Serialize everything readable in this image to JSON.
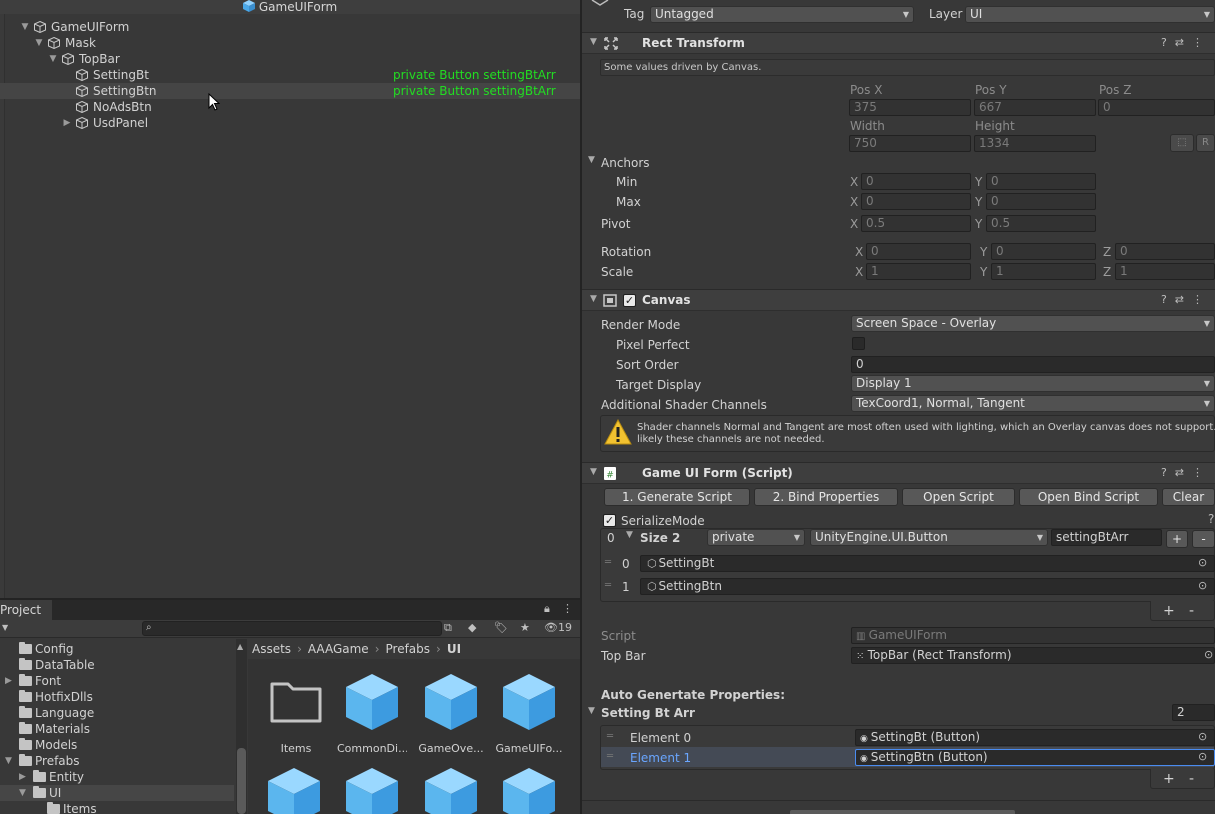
{
  "hierarchy": {
    "title": "GameUIForm",
    "rows": [
      {
        "label": "GameUIForm",
        "green": ""
      },
      {
        "label": "Mask",
        "green": ""
      },
      {
        "label": "TopBar",
        "green": ""
      },
      {
        "label": "SettingBt",
        "green": "private Button settingBtArr"
      },
      {
        "label": "SettingBtn",
        "green": "private Button settingBtArr"
      },
      {
        "label": "NoAdsBtn",
        "green": ""
      },
      {
        "label": "UsdPanel",
        "green": ""
      }
    ]
  },
  "project": {
    "tab": "Project",
    "hidden_count": "19",
    "tree": [
      "Config",
      "DataTable",
      "Font",
      "HotfixDlls",
      "Language",
      "Materials",
      "Models",
      "Prefabs",
      "Entity",
      "UI",
      "Items"
    ],
    "breadcrumb": [
      "Assets",
      "AAAGame",
      "Prefabs",
      "UI"
    ],
    "assets": [
      "Items",
      "CommonDi...",
      "GameOve...",
      "GameUIFo..."
    ]
  },
  "inspector": {
    "tag_label": "Tag",
    "tag_value": "Untagged",
    "layer_label": "Layer",
    "layer_value": "UI",
    "rect": {
      "title": "Rect Transform",
      "note": "Some values driven by Canvas.",
      "pos_x_label": "Pos X",
      "pos_y_label": "Pos Y",
      "pos_z_label": "Pos Z",
      "pos_x": "375",
      "pos_y": "667",
      "pos_z": "0",
      "width_label": "Width",
      "height_label": "Height",
      "width": "750",
      "height": "1334",
      "r_button": "R",
      "anchors": "Anchors",
      "min": "Min",
      "max": "Max",
      "min_x": "0",
      "min_y": "0",
      "max_x": "0",
      "max_y": "0",
      "pivot": "Pivot",
      "pivot_x": "0.5",
      "pivot_y": "0.5",
      "rotation": "Rotation",
      "rot_x": "0",
      "rot_y": "0",
      "rot_z": "0",
      "scale": "Scale",
      "scale_x": "1",
      "scale_y": "1",
      "scale_z": "1",
      "ax_x": "X",
      "ax_y": "Y",
      "ax_z": "Z"
    },
    "canvas": {
      "title": "Canvas",
      "render_mode_label": "Render Mode",
      "render_mode": "Screen Space - Overlay",
      "pixel_perfect": "Pixel Perfect",
      "sort_order_label": "Sort Order",
      "sort_order": "0",
      "target_display_label": "Target Display",
      "target_display": "Display 1",
      "shader_channels_label": "Additional Shader Channels",
      "shader_channels": "TexCoord1, Normal, Tangent",
      "warning_line1": "Shader channels Normal and Tangent are most often used with lighting, which an Overlay canvas does not support. Its",
      "warning_line2": "likely these channels are not needed."
    },
    "script": {
      "title": "Game UI Form (Script)",
      "buttons": [
        "1. Generate Script",
        "2. Bind Properties",
        "Open Script",
        "Open Bind Script",
        "Clear"
      ],
      "serialize_mode": "SerializeMode",
      "index": "0",
      "size": "Size 2",
      "access": "private",
      "type": "UnityEngine.UI.Button",
      "var_name": "settingBtArr",
      "plus": "+",
      "minus": "-",
      "list": [
        {
          "idx": "0",
          "obj": "SettingBt"
        },
        {
          "idx": "1",
          "obj": "SettingBtn"
        }
      ],
      "script_label": "Script",
      "script_value": "GameUIForm",
      "topbar_label": "Top Bar",
      "topbar_value": "TopBar (Rect Transform)",
      "auto_props": "Auto Genertate Properties:",
      "arr_label": "Setting Bt Arr",
      "arr_size": "2",
      "elements": [
        {
          "label": "Element 0",
          "value": "SettingBt (Button)"
        },
        {
          "label": "Element 1",
          "value": "SettingBtn (Button)"
        }
      ]
    }
  }
}
